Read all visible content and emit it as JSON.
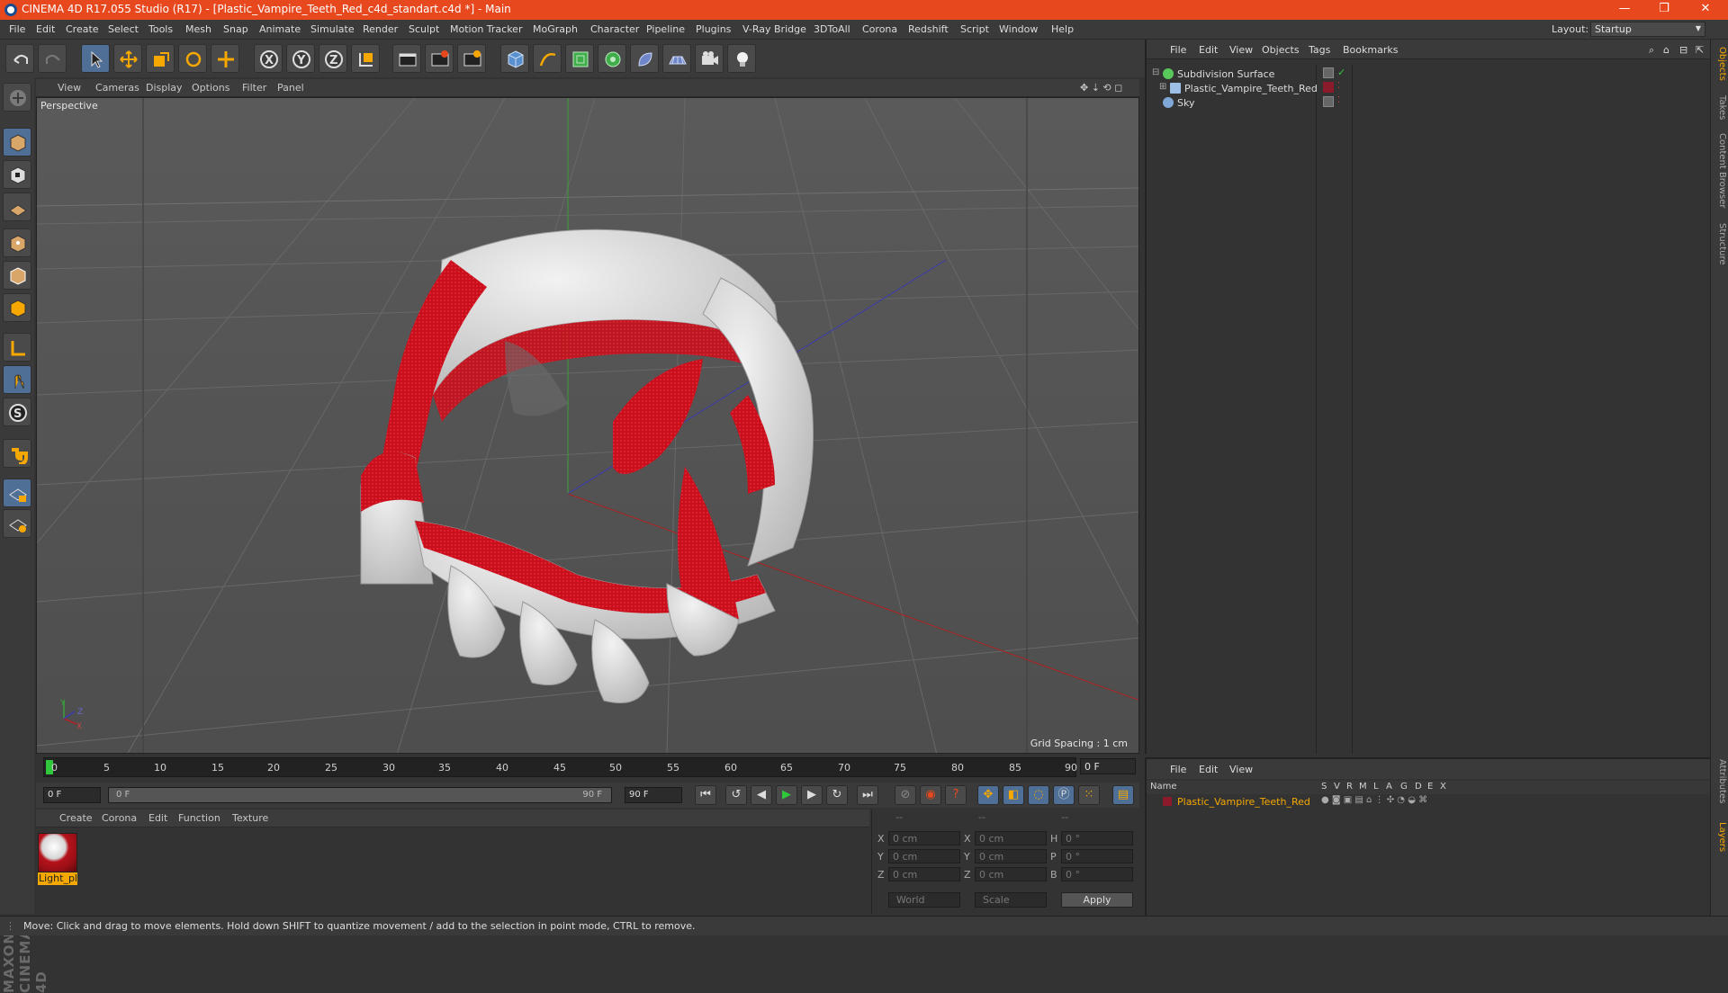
{
  "window": {
    "title": "CINEMA 4D R17.055 Studio (R17) - [Plastic_Vampire_Teeth_Red_c4d_standart.c4d *] - Main",
    "minimize": "—",
    "maximize": "❐",
    "close": "✕"
  },
  "menubar": {
    "items": [
      "File",
      "Edit",
      "Create",
      "Select",
      "Tools",
      "Mesh",
      "Snap",
      "Animate",
      "Simulate",
      "Render",
      "Sculpt",
      "Motion Tracker",
      "MoGraph",
      "Character",
      "Pipeline",
      "Plugins",
      "V-Ray Bridge",
      "3DToAll",
      "Corona",
      "Redshift",
      "Script",
      "Window",
      "Help"
    ],
    "layout_label": "Layout:",
    "layout_value": "Startup"
  },
  "viewport": {
    "menu": [
      "View",
      "Cameras",
      "Display",
      "Options",
      "Filter",
      "Panel"
    ],
    "label": "Perspective",
    "grid_spacing": "Grid Spacing : 1 cm",
    "axis_labels": {
      "y": "Y",
      "z": "Z",
      "x": "X"
    }
  },
  "timeline": {
    "ticks": [
      "0",
      "5",
      "10",
      "15",
      "20",
      "25",
      "30",
      "35",
      "40",
      "45",
      "50",
      "55",
      "60",
      "65",
      "70",
      "75",
      "80",
      "85",
      "90"
    ],
    "end_frame": "0 F",
    "current_frame": "0 F",
    "range_start": "0 F",
    "range_end_in": "90 F",
    "range_end": "90 F"
  },
  "material_manager": {
    "menu": [
      "Create",
      "Corona",
      "Edit",
      "Function",
      "Texture"
    ],
    "materials": [
      {
        "name": "Light_pl"
      }
    ]
  },
  "coordinates": {
    "header": [
      "--",
      "--",
      "--"
    ],
    "rows": [
      {
        "l1": "X",
        "v1": "0 cm",
        "l2": "X",
        "v2": "0 cm",
        "l3": "H",
        "v3": "0 °"
      },
      {
        "l1": "Y",
        "v1": "0 cm",
        "l2": "Y",
        "v2": "0 cm",
        "l3": "P",
        "v3": "0 °"
      },
      {
        "l1": "Z",
        "v1": "0 cm",
        "l2": "Z",
        "v2": "0 cm",
        "l3": "B",
        "v3": "0 °"
      }
    ],
    "space": "World",
    "mode": "Scale",
    "apply": "Apply"
  },
  "object_manager": {
    "menu": [
      "File",
      "Edit",
      "View",
      "Objects",
      "Tags",
      "Bookmarks"
    ],
    "objects": [
      {
        "name": "Subdivision Surface",
        "icon_color": "#58c85a"
      },
      {
        "name": "Plastic_Vampire_Teeth_Red",
        "icon_color": "#9ec0e8",
        "tag_color": "#8b1a2a"
      },
      {
        "name": "Sky",
        "icon_color": "#7fa7d8"
      }
    ]
  },
  "layer_manager": {
    "menu": [
      "File",
      "Edit",
      "View"
    ],
    "columns": [
      "Name",
      "S",
      "V",
      "R",
      "M",
      "L",
      "A",
      "G",
      "D",
      "E",
      "X"
    ],
    "layers": [
      {
        "name": "Plastic_Vampire_Teeth_Red",
        "color": "#8b1a2a"
      }
    ]
  },
  "side_tabs": [
    "Objects",
    "Takes",
    "Content Browser",
    "Structure",
    "Attributes",
    "Layers"
  ],
  "status": "Move: Click and drag to move elements. Hold down SHIFT to quantize movement / add to the selection in point mode, CTRL to remove.",
  "brand": "MAXON CINEMA 4D",
  "colors": {
    "title_bar": "#e8481d",
    "accent": "#f6a800",
    "blood_red": "#c8101c",
    "tooth_white": "#e6e6e6"
  }
}
